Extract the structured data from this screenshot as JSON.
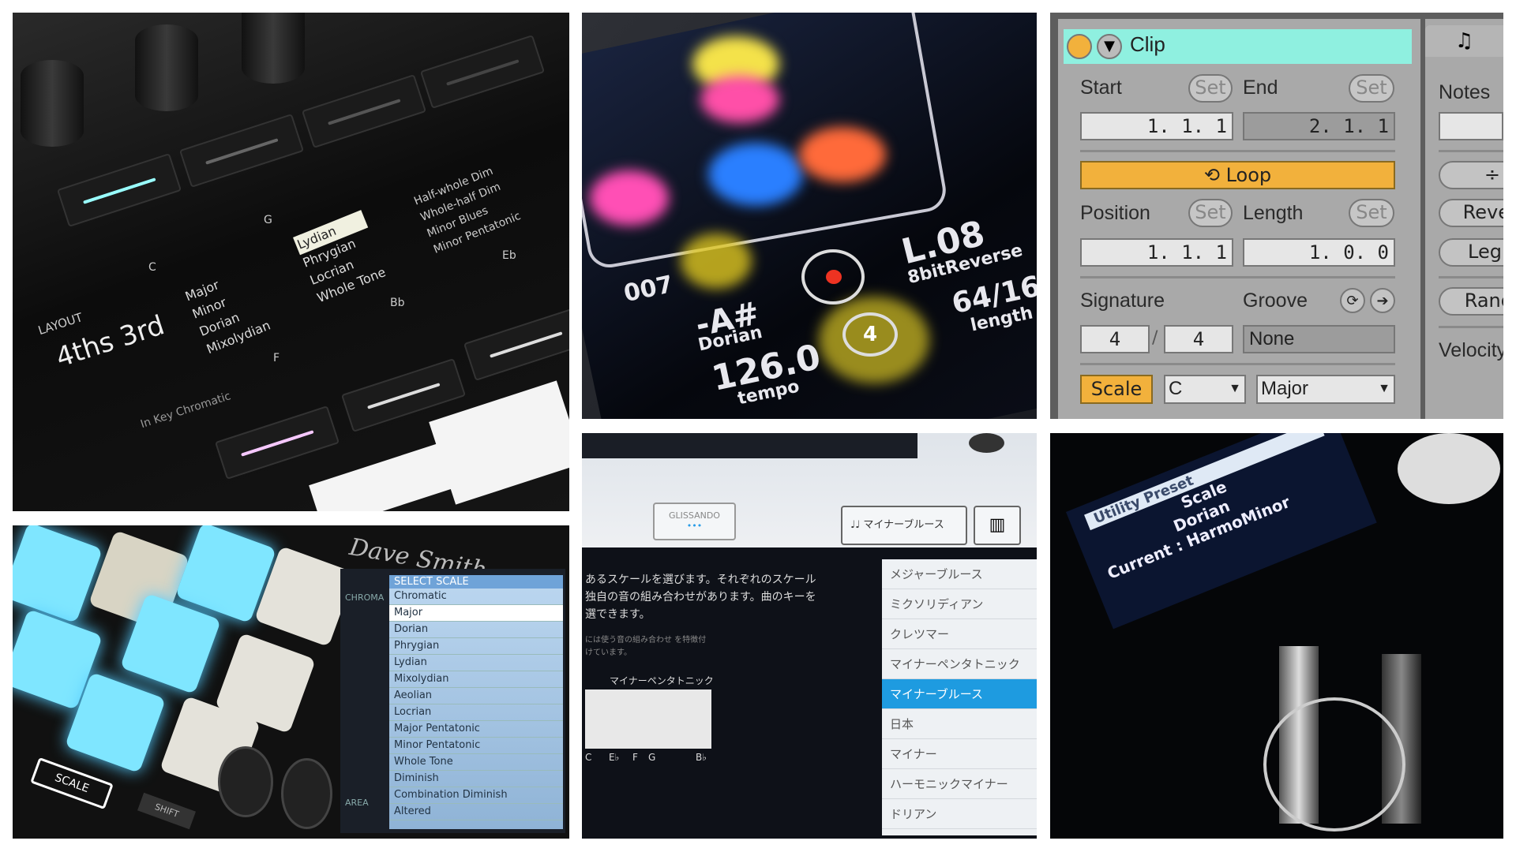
{
  "panel_layout": {
    "layout_label": "LAYOUT",
    "layout_value": "4ths 3rd",
    "scale_columns": [
      [
        "Major",
        "Minor",
        "Dorian",
        "Mixolydian"
      ],
      [
        "Lydian",
        "Phrygian",
        "Locrian",
        "Whole Tone"
      ],
      [
        "Half-whole Dim",
        "Whole-half Dim",
        "Minor Blues",
        "Minor Pentatonic"
      ]
    ],
    "roots": [
      "C",
      "G",
      "F",
      "Bb",
      "Eb"
    ],
    "mode_label": "In Key Chromatic"
  },
  "panel_phone": {
    "preset_num": "007",
    "preset_name": "L.08",
    "preset_sub": "8bitReverse",
    "key": "-A#",
    "scale": "Dorian",
    "tempo": "126.0",
    "tempo_label": "tempo",
    "length": "64/16",
    "length_label": "length",
    "count": "4"
  },
  "clip_panel": {
    "title": "Clip",
    "header_color": "#8ff0e0",
    "accent": "#f2b13c",
    "start_label": "Start",
    "end_label": "End",
    "set_label": "Set",
    "start_value": "1.  1.  1",
    "end_value": "2.  1.  1",
    "loop_label": "Loop",
    "position_label": "Position",
    "length_label": "Length",
    "position_value": "1.  1.  1",
    "length_value": "1.  0.  0",
    "signature_label": "Signature",
    "groove_label": "Groove",
    "sig_num": "4",
    "sig_den": "4",
    "groove_value": "None",
    "scale_label": "Scale",
    "scale_root": "C",
    "scale_mode": "Major",
    "notes_label": "Notes",
    "side_buttons": [
      "÷",
      "Reve",
      "Leg",
      "Rand"
    ],
    "velocity_label": "Velocity"
  },
  "panel_pads": {
    "header": "SELECT SCALE",
    "brand": "Dave Smith",
    "scales": [
      "Chromatic",
      "Major",
      "Dorian",
      "Phrygian",
      "Lydian",
      "Mixolydian",
      "Aeolian",
      "Locrian",
      "Major Pentatonic",
      "Minor Pentatonic",
      "Whole Tone",
      "Diminish",
      "Combination Diminish",
      "Altered"
    ],
    "side_labels": [
      "CHROMA",
      "AREA"
    ],
    "scale_button": "SCALE",
    "shift_button": "SHIFT"
  },
  "panel_app": {
    "glissando_label": "GLISSANDO",
    "scale_button": "マイナーブルース",
    "description": "あるスケールを選びます。それぞれのスケール 独自の音の組み合わせがあります。曲のキーを 選できます。",
    "note_small": "には使う音の組み合わせ を特徴付けています。",
    "keyboard_title": "マイナーペンタトニック",
    "keyboard_notes": [
      "C",
      "E♭",
      "F",
      "G",
      "B♭"
    ],
    "scales": [
      "メジャーブルース",
      "ミクソリディアン",
      "クレツマー",
      "マイナーペンタトニック",
      "マイナーブルース",
      "日本",
      "マイナー",
      "ハーモニックマイナー",
      "ドリアン"
    ],
    "selected_index": 4,
    "selected_color": "#1e9be0"
  },
  "panel_oled": {
    "line1": "Utility Preset",
    "line2": "Scale",
    "line3": "Dorian",
    "line4": "Current : HarmoMinor"
  }
}
